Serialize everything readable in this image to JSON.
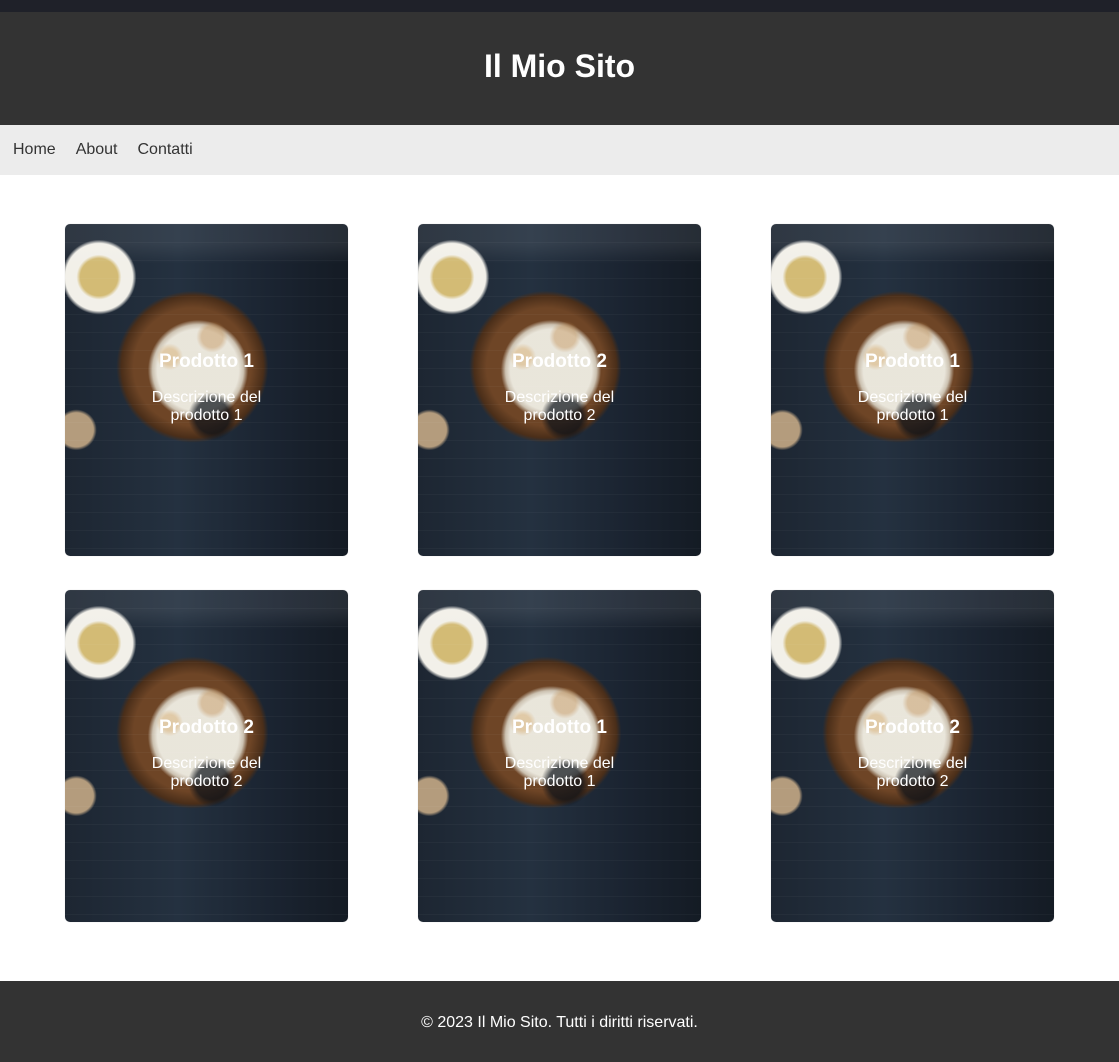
{
  "header": {
    "title": "Il Mio Sito"
  },
  "nav": {
    "items": [
      {
        "label": "Home"
      },
      {
        "label": "About"
      },
      {
        "label": "Contatti"
      }
    ]
  },
  "products": [
    {
      "title": "Prodotto 1",
      "description": "Descrizione del prodotto 1"
    },
    {
      "title": "Prodotto 2",
      "description": "Descrizione del prodotto 2"
    },
    {
      "title": "Prodotto 1",
      "description": "Descrizione del prodotto 1"
    },
    {
      "title": "Prodotto 2",
      "description": "Descrizione del prodotto 2"
    },
    {
      "title": "Prodotto 1",
      "description": "Descrizione del prodotto 1"
    },
    {
      "title": "Prodotto 2",
      "description": "Descrizione del prodotto 2"
    }
  ],
  "footer": {
    "text": "© 2023 Il Mio Sito. Tutti i diritti riservati."
  },
  "colors": {
    "header_bg": "#333333",
    "nav_bg": "#ececec",
    "page_bg": "#ffffff",
    "card_text": "#ffffff"
  }
}
